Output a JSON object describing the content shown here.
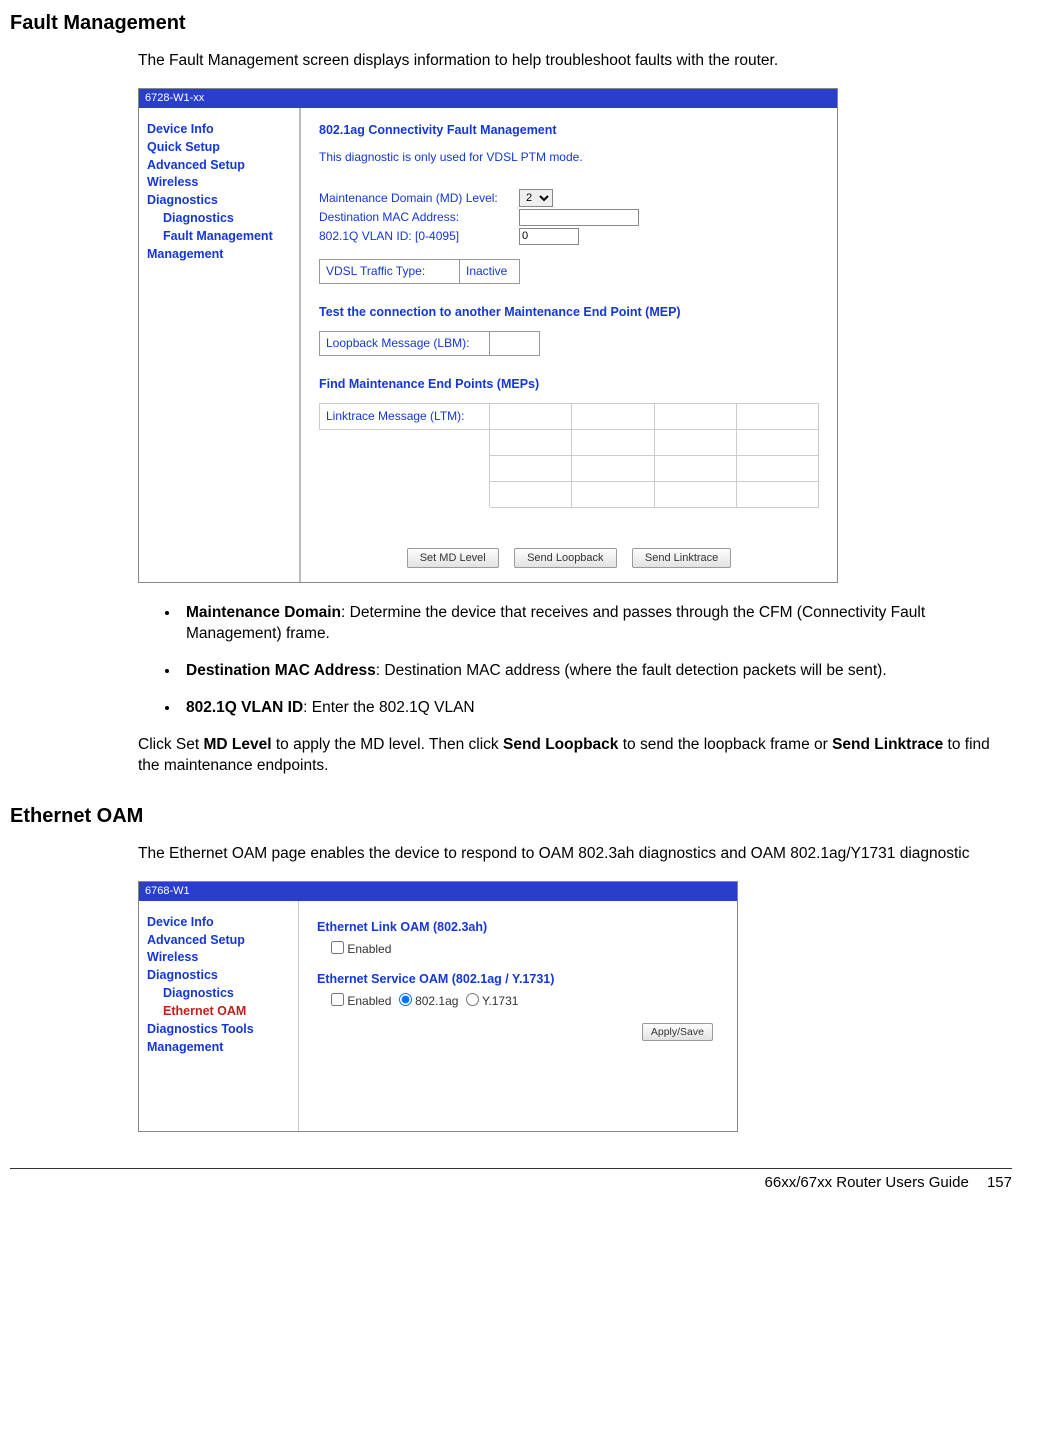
{
  "headings": {
    "fault_management": "Fault Management",
    "ethernet_oam": "Ethernet OAM"
  },
  "intro_fm": "The Fault Management screen displays information to help troubleshoot faults with the router.",
  "intro_oam": "The Ethernet OAM page enables the device to respond to OAM 802.3ah diagnostics and OAM 802.1ag/Y1731 diagnostic",
  "bullets": {
    "md_label": "Maintenance Domain",
    "md_text": ":  Determine the device that receives and passes through the CFM (Connectivity Fault Management) frame.",
    "mac_label": "Destination MAC Address",
    "mac_text": ": Destination MAC address (where the fault detection packets will be sent).",
    "vlan_label": "802.1Q VLAN ID",
    "vlan_text": ": Enter the 802.1Q VLAN"
  },
  "click_para": {
    "p1": "Click Set ",
    "b1": "MD Level",
    "p2": " to apply the MD level. Then click ",
    "b2": "Send Loopback",
    "p3": " to send the loopback frame or ",
    "b3": "Send Linktrace",
    "p4": " to find the maintenance endpoints."
  },
  "shot1": {
    "title": "6728-W1-xx",
    "nav": {
      "device_info": "Device Info",
      "quick_setup": "Quick Setup",
      "advanced_setup": "Advanced Setup",
      "wireless": "Wireless",
      "diagnostics": "Diagnostics",
      "diagnostics_sub": "Diagnostics",
      "fault_management": "Fault Management",
      "management": "Management"
    },
    "main": {
      "heading": "802.1ag Connectivity Fault Management",
      "sub": "This diagnostic is only used for VDSL PTM mode.",
      "md_level_label": "Maintenance Domain (MD) Level:",
      "md_level_value": "2",
      "dest_mac_label": "Destination MAC Address:",
      "vlan_label": "802.1Q VLAN ID: [0-4095]",
      "vlan_value": "0",
      "traffic_type_label": "VDSL Traffic Type:",
      "traffic_type_value": "Inactive",
      "test_heading": "Test the connection to another Maintenance End Point (MEP)",
      "lbm_label": "Loopback Message (LBM):",
      "find_heading": "Find Maintenance End Points (MEPs)",
      "ltm_label": "Linktrace Message (LTM):",
      "btn_md": "Set MD Level",
      "btn_loop": "Send Loopback",
      "btn_link": "Send Linktrace"
    }
  },
  "shot2": {
    "title": "6768-W1",
    "nav": {
      "device_info": "Device Info",
      "advanced_setup": "Advanced Setup",
      "wireless": "Wireless",
      "diagnostics": "Diagnostics",
      "diagnostics_sub": "Diagnostics",
      "ethernet_oam": "Ethernet OAM",
      "diag_tools": "Diagnostics Tools",
      "management": "Management"
    },
    "main": {
      "link_head": "Ethernet Link OAM (802.3ah)",
      "enabled": "Enabled",
      "svc_head": "Ethernet Service OAM (802.1ag / Y.1731)",
      "r1": "802.1ag",
      "r2": "Y.1731",
      "apply": "Apply/Save"
    }
  },
  "footer": {
    "guide": "66xx/67xx Router Users Guide",
    "page": "157"
  }
}
